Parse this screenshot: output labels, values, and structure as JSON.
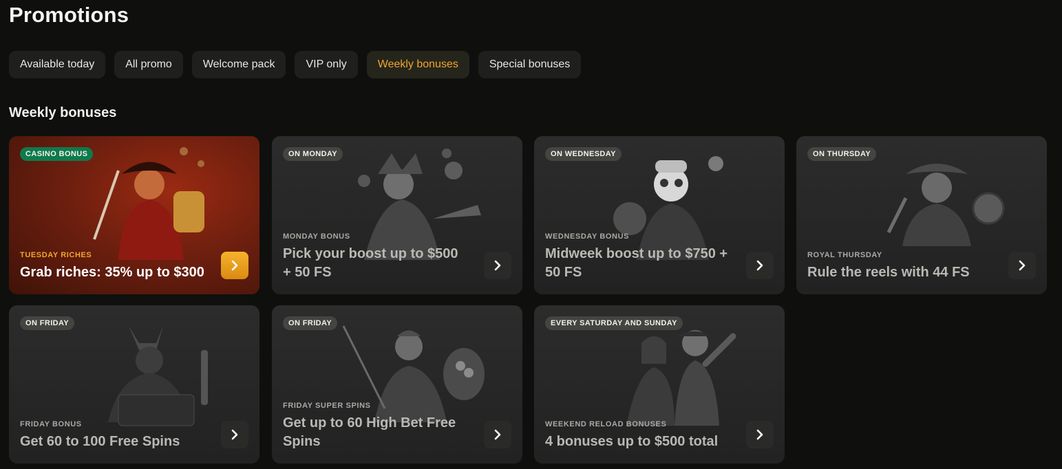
{
  "page": {
    "title": "Promotions"
  },
  "tabs": [
    {
      "label": "Available today",
      "active": false
    },
    {
      "label": "All promo",
      "active": false
    },
    {
      "label": "Welcome pack",
      "active": false
    },
    {
      "label": "VIP only",
      "active": false
    },
    {
      "label": "Weekly bonuses",
      "active": true
    },
    {
      "label": "Special bonuses",
      "active": false
    }
  ],
  "section": {
    "title": "Weekly bonuses"
  },
  "colors": {
    "accent": "#f2a62b",
    "badge_green": "#0f7a4c",
    "background": "#0f100e"
  },
  "cards": [
    {
      "badge": "CASINO BONUS",
      "eyebrow": "TUESDAY RICHES",
      "headline": "Grab riches: 35% up to $300",
      "art": "pirate-captain-illustration",
      "featured": true
    },
    {
      "badge": "ON MONDAY",
      "eyebrow": "MONDAY BONUS",
      "headline": "Pick your boost up to $500 + 50 FS",
      "art": "jester-illustration"
    },
    {
      "badge": "ON WEDNESDAY",
      "eyebrow": "WEDNESDAY BONUS",
      "headline": "Midweek boost up to $750 + 50 FS",
      "art": "panda-chef-illustration"
    },
    {
      "badge": "ON THURSDAY",
      "eyebrow": "ROYAL THURSDAY",
      "headline": "Rule the reels with 44 FS",
      "art": "cowboy-illustration"
    },
    {
      "badge": "ON FRIDAY",
      "eyebrow": "FRIDAY BONUS",
      "headline": "Get 60 to 100 Free Spins",
      "art": "anubis-slot-illustration"
    },
    {
      "badge": "ON FRIDAY",
      "eyebrow": "FRIDAY SUPER SPINS",
      "headline": "Get up to 60 High Bet Free Spins",
      "art": "fisherman-illustration"
    },
    {
      "badge": "EVERY SATURDAY AND SUNDAY",
      "eyebrow": "WEEKEND RELOAD BONUSES",
      "headline": "4 bonuses up to $500 total",
      "art": "dancing-couple-illustration"
    }
  ]
}
